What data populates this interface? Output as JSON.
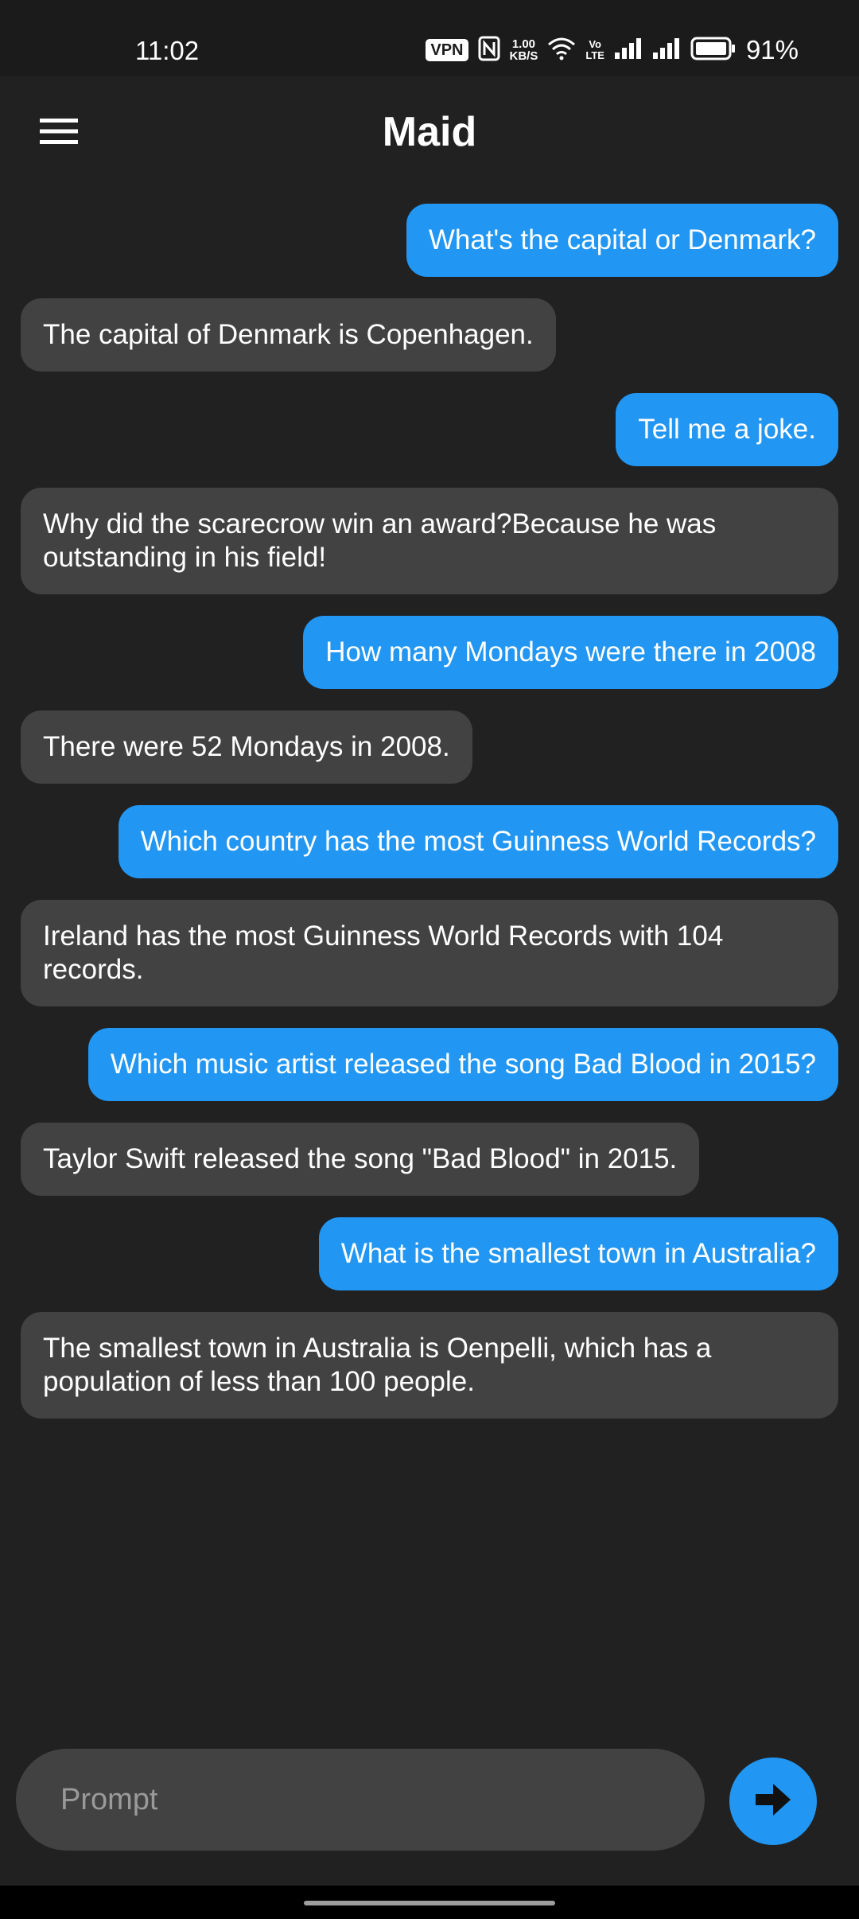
{
  "status_bar": {
    "time": "11:02",
    "vpn_label": "VPN",
    "net_speed_value": "1.00",
    "net_speed_unit": "KB/S",
    "volte_top": "Vo",
    "volte_bottom": "LTE",
    "battery_percent": "91%",
    "icons": [
      "vpn-icon",
      "nfc-icon",
      "wifi-icon",
      "volte-icon",
      "signal-icon",
      "signal-icon",
      "battery-icon"
    ]
  },
  "app_bar": {
    "title": "Maid",
    "menu_icon": "hamburger-menu-icon"
  },
  "messages": [
    {
      "role": "user",
      "text": "What's the capital or Denmark?"
    },
    {
      "role": "assistant",
      "text": "The capital of Denmark is Copenhagen."
    },
    {
      "role": "user",
      "text": "Tell me a joke."
    },
    {
      "role": "assistant",
      "text": "Why did the scarecrow win an award?Because he was outstanding in his field!"
    },
    {
      "role": "user",
      "text": "How many Mondays were there in 2008"
    },
    {
      "role": "assistant",
      "text": "There were 52 Mondays in 2008."
    },
    {
      "role": "user",
      "text": "Which country has the most Guinness World Records?"
    },
    {
      "role": "assistant",
      "text": "Ireland has the most Guinness World Records with 104 records."
    },
    {
      "role": "user",
      "text": "Which music artist released the song Bad Blood in 2015?"
    },
    {
      "role": "assistant",
      "text": "Taylor Swift released the song \"Bad Blood\" in 2015."
    },
    {
      "role": "user",
      "text": "What is the smallest town in Australia?"
    },
    {
      "role": "assistant",
      "text": "The smallest town in Australia is Oenpelli, which has a population of less than 100 people."
    }
  ],
  "input": {
    "placeholder": "Prompt",
    "value": ""
  },
  "send_button": {
    "icon": "arrow-right-icon"
  },
  "colors": {
    "background": "#212121",
    "user_bubble": "#2196f3",
    "assistant_bubble": "#424242",
    "accent": "#2196f3"
  }
}
